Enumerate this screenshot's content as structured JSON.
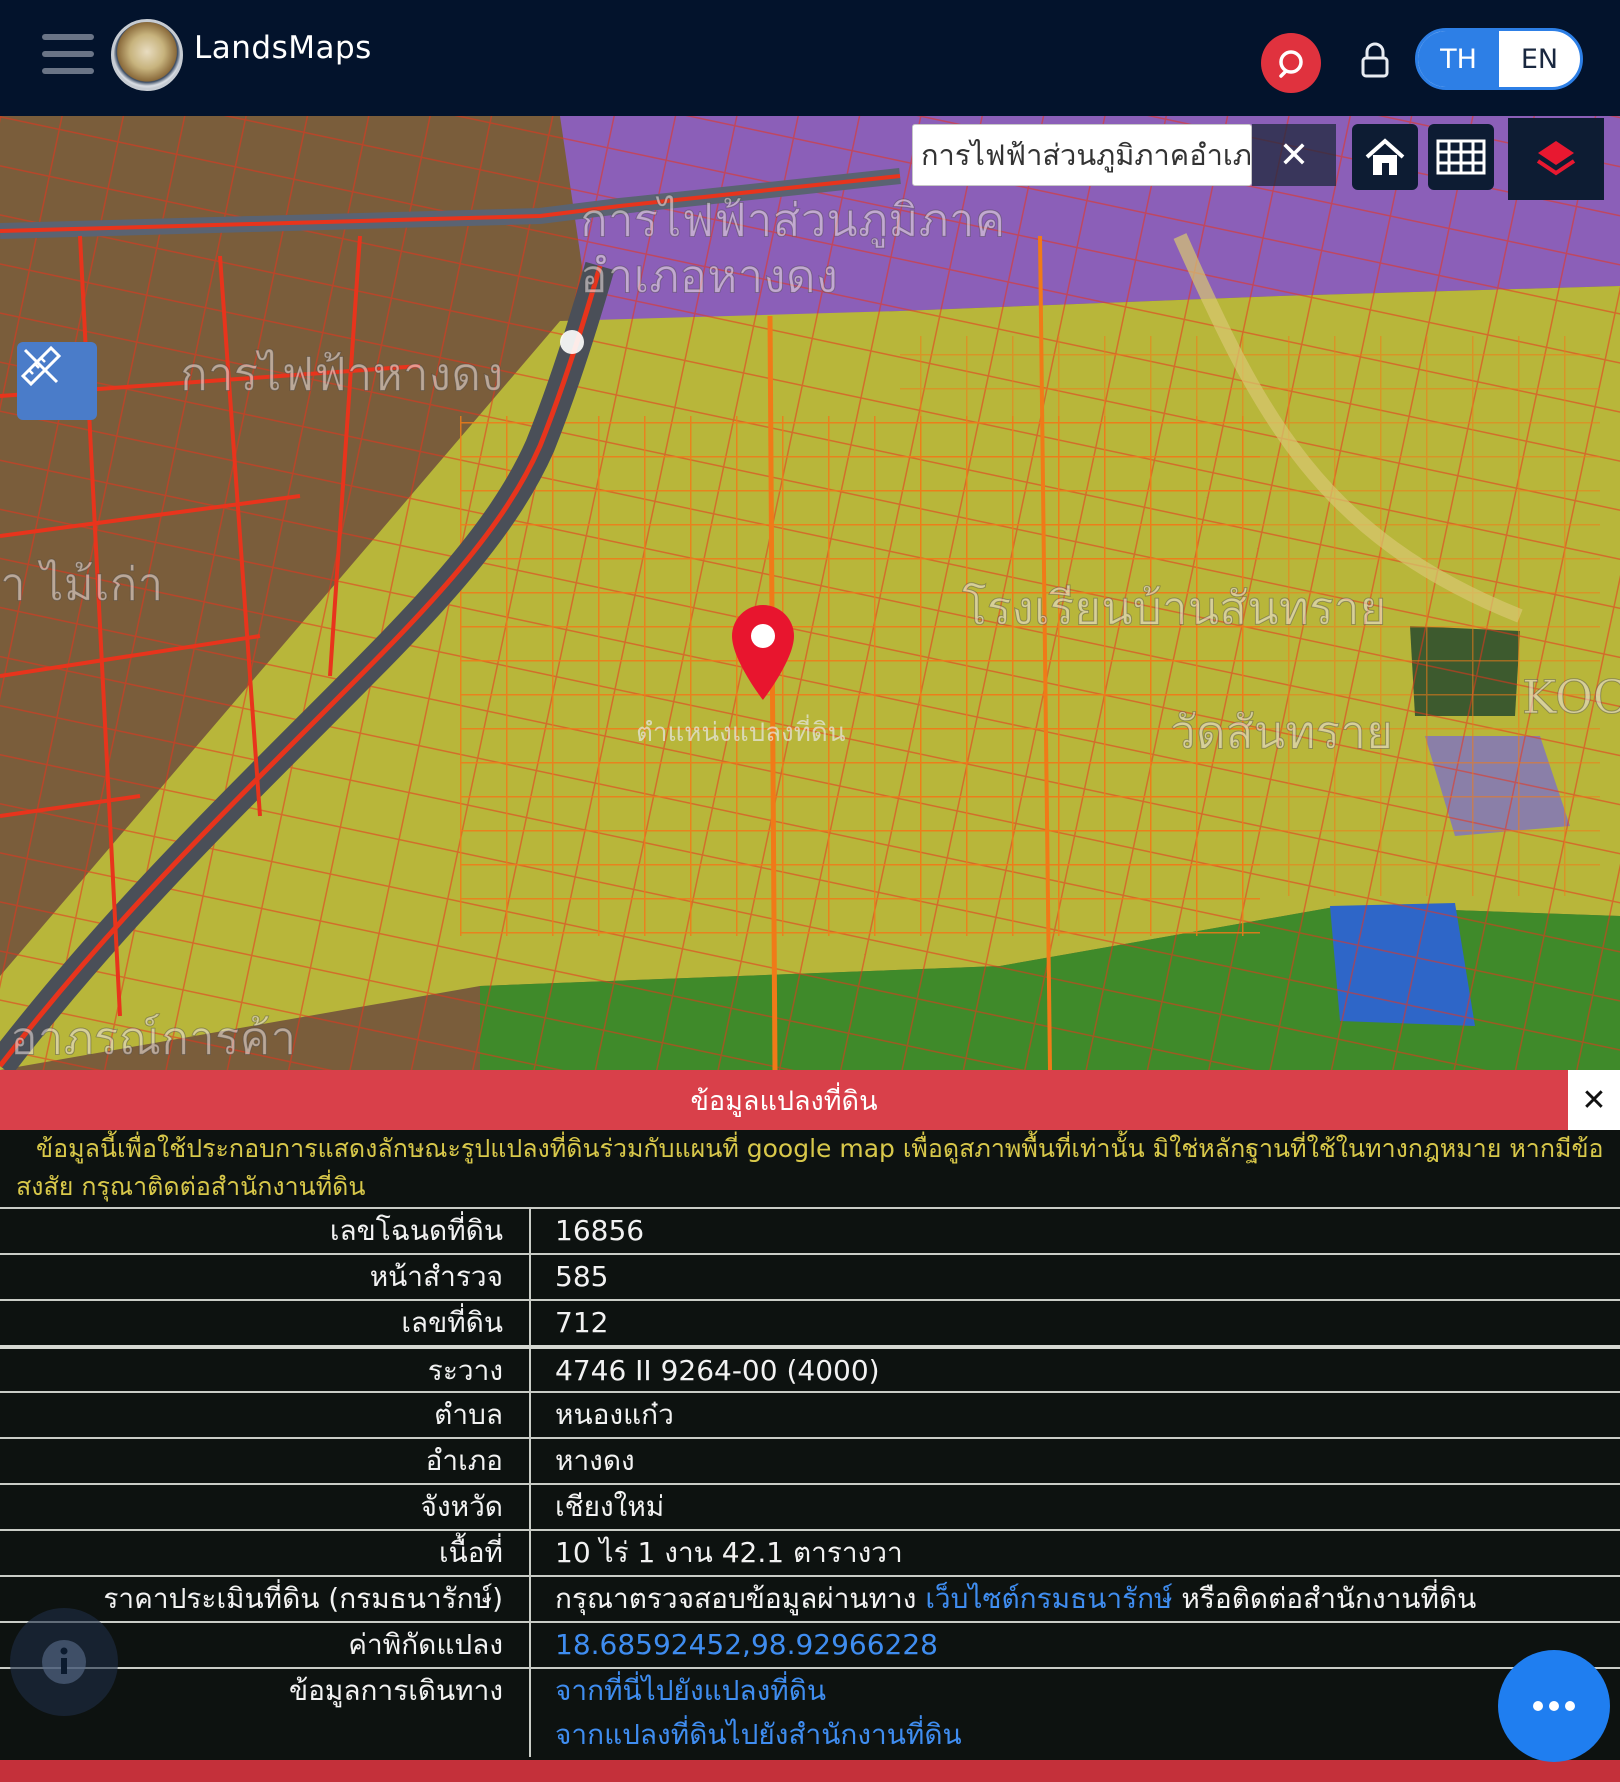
{
  "header": {
    "brand": "LandsMaps",
    "lang_th": "TH",
    "lang_en": "EN"
  },
  "map": {
    "search_value": "การไฟฟ้าส่วนภูมิภาคอำเภ",
    "clear_symbol": "✕",
    "marker_label": "ตำแหน่งแปลงที่ดิน",
    "place_labels": [
      "การไฟฟ้าส่วนภูมิภาค",
      "อำเภอหางดง",
      "การไฟฟ้าหางดง",
      "า ไม้เก่า",
      "โรงเรียนบ้านสันทราย",
      "วัดสันทราย",
      "KOC",
      "อาภรณ์การค้า"
    ]
  },
  "panel": {
    "title": "ข้อมูลแปลงที่ดิน",
    "close_symbol": "✕",
    "disclaimer": "ข้อมูลนี้เพื่อใช้ประกอบการแสดงลักษณะรูปแปลงที่ดินร่วมกับแผนที่ google map เพื่อดูสภาพพื้นที่เท่านั้น มิใช่หลักฐานที่ใช้ในทางกฎหมาย หากมีข้อสงสัย กรุณาติดต่อสำนักงานที่ดิน",
    "rows": [
      {
        "label": "เลขโฉนดที่ดิน",
        "value": "16856"
      },
      {
        "label": "หน้าสำรวจ",
        "value": "585"
      },
      {
        "label": "เลขที่ดิน",
        "value": "712"
      },
      {
        "label": "ระวาง",
        "value": "4746 II 9264-00 (4000)"
      },
      {
        "label": "ตำบล",
        "value": "หนองแก๋ว"
      },
      {
        "label": "อำเภอ",
        "value": "หางดง"
      },
      {
        "label": "จังหวัด",
        "value": "เชียงใหม่"
      },
      {
        "label": "เนื้อที่",
        "value": "10 ไร่ 1 งาน 42.1 ตารางวา"
      }
    ],
    "price_label": "ราคาประเมินที่ดิน (กรมธนารักษ์)",
    "price_prefix": "กรุณาตรวจสอบข้อมูลผ่านทาง",
    "price_link": "เว็บไซต์กรมธนารักษ์",
    "price_suffix": "หรือติดต่อสำนักงานที่ดิน",
    "coord_label": "ค่าพิกัดแปลง",
    "coord_value": "18.68592452,98.92966228",
    "travel_label": "ข้อมูลการเดินทาง",
    "travel_link_1": "จากที่นี่ไปยังแปลงที่ดิน",
    "travel_link_2": "จากแปลงที่ดินไปยังสำนักงานที่ดิน"
  },
  "colors": {
    "header_bg": "#03132c",
    "accent_red": "#d9404a",
    "accent_blue": "#2d7fe6",
    "link_blue": "#3f8df0",
    "disclaimer_yellow": "#d8c84a"
  },
  "icons": [
    "menu-icon",
    "search-icon",
    "lock-icon",
    "home-icon",
    "grid-icon",
    "layers-icon",
    "ruler-pencil-icon",
    "map-pin-icon",
    "info-icon",
    "more-icon"
  ]
}
